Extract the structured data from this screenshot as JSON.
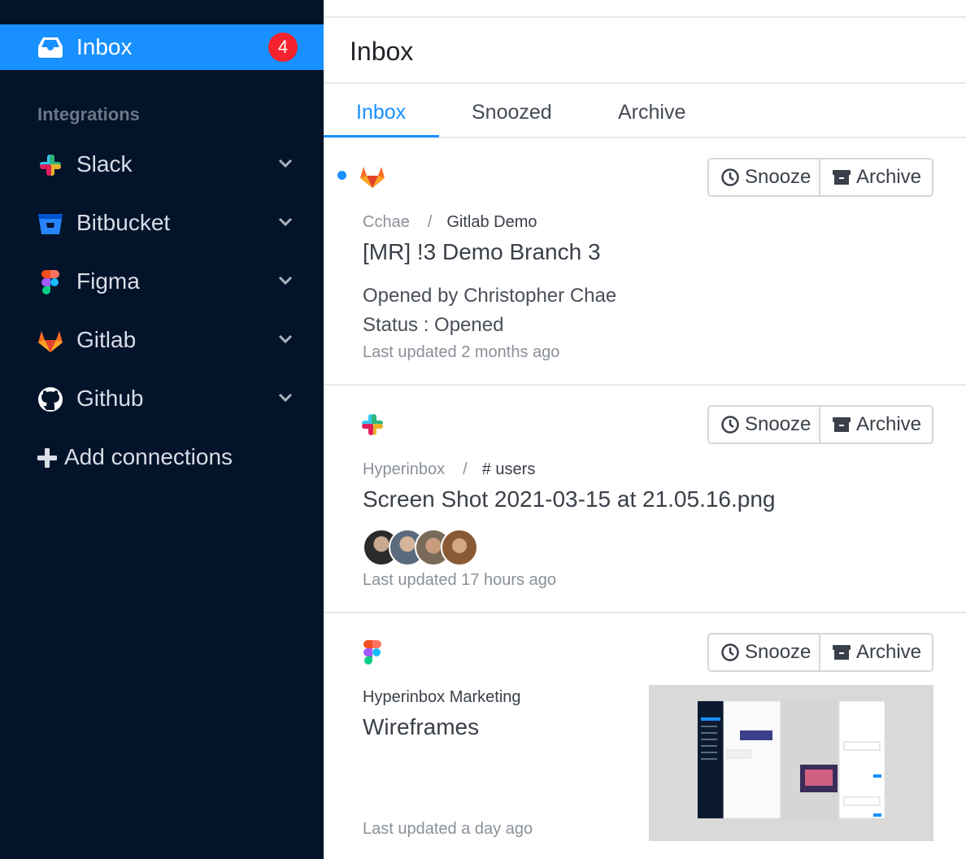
{
  "sidebar": {
    "inbox": {
      "label": "Inbox",
      "badge": "4",
      "icon": "inbox-icon"
    },
    "section_title": "Integrations",
    "items": [
      {
        "label": "Slack",
        "icon": "slack-icon"
      },
      {
        "label": "Bitbucket",
        "icon": "bitbucket-icon"
      },
      {
        "label": "Figma",
        "icon": "figma-icon"
      },
      {
        "label": "Gitlab",
        "icon": "gitlab-icon"
      },
      {
        "label": "Github",
        "icon": "github-icon"
      }
    ],
    "add_connections": "Add connections"
  },
  "main": {
    "title": "Inbox",
    "tabs": [
      {
        "label": "Inbox",
        "active": true
      },
      {
        "label": "Snoozed",
        "active": false
      },
      {
        "label": "Archive",
        "active": false
      }
    ],
    "snooze_label": "Snooze",
    "archive_label": "Archive",
    "cards": [
      {
        "source": "gitlab-icon",
        "unread": true,
        "crumb_parent": "Cchae",
        "crumb_sep": "/",
        "crumb_leaf": "Gitlab Demo",
        "title": "[MR] !3 Demo Branch 3",
        "details": [
          "Opened by Christopher Chae",
          "Status : Opened"
        ],
        "updated": "Last updated 2 months ago"
      },
      {
        "source": "slack-icon",
        "unread": false,
        "crumb_parent": "Hyperinbox",
        "crumb_sep": "/",
        "crumb_leaf": "# users",
        "title": "Screen Shot 2021-03-15 at 21.05.16.png",
        "updated": "Last updated 17 hours ago"
      },
      {
        "source": "figma-icon",
        "unread": false,
        "crumb_leaf": "Hyperinbox Marketing",
        "title": "Wireframes",
        "updated": "Last updated a day ago"
      }
    ]
  },
  "colors": {
    "sidebar_bg": "#03132a",
    "accent": "#1890ff",
    "badge": "#f5222d"
  }
}
